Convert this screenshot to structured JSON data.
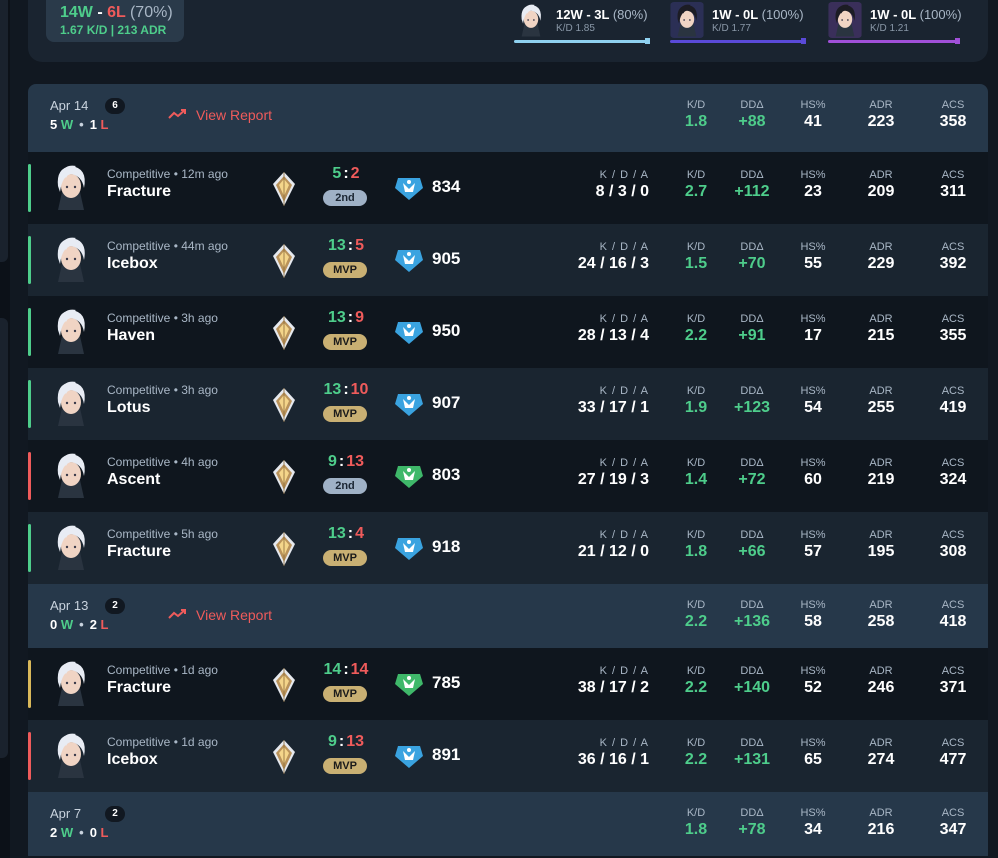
{
  "summary": {
    "wins": "14W",
    "dash": " - ",
    "losses": "6L",
    "winrate": "(70%)",
    "kd_adr": "1.67 K/D | 213 ADR"
  },
  "agent_stats": [
    {
      "record": "12W - 3L",
      "pct": "(80%)",
      "kd": "K/D 1.85",
      "bar_color": "#8fd1f0"
    },
    {
      "record": "1W - 0L",
      "pct": "(100%)",
      "kd": "K/D 1.77",
      "bar_color": "#5a4ad8"
    },
    {
      "record": "1W - 0L",
      "pct": "(100%)",
      "kd": "K/D 1.21",
      "bar_color": "#a050d8"
    }
  ],
  "stat_labels": {
    "kd": "K/D",
    "dd": "DDΔ",
    "hs": "HS%",
    "adr": "ADR",
    "acs": "ACS",
    "kda": "K / D / A"
  },
  "days": [
    {
      "date": "Apr 14",
      "count": "6",
      "wins": "5",
      "w": "W",
      "dot": "•",
      "losses": "1",
      "l": "L",
      "report": "View Report",
      "kd": "1.8",
      "dd": "+88",
      "hs": "41",
      "adr": "223",
      "acs": "358"
    },
    {
      "date": "Apr 13",
      "count": "2",
      "wins": "0",
      "w": "W",
      "dot": "•",
      "losses": "2",
      "l": "L",
      "report": "View Report",
      "kd": "2.2",
      "dd": "+136",
      "hs": "58",
      "adr": "258",
      "acs": "418"
    },
    {
      "date": "Apr 7",
      "count": "2",
      "wins": "2",
      "w": "W",
      "dot": "•",
      "losses": "0",
      "l": "L",
      "kd": "1.8",
      "dd": "+78",
      "hs": "34",
      "adr": "216",
      "acs": "347"
    }
  ],
  "matches": [
    {
      "mode": "Competitive • 12m ago",
      "map": "Fracture",
      "score_a": "5",
      "score_b": "2",
      "badge": "2nd",
      "rr": "834",
      "kda": "8 / 3 / 0",
      "kd": "2.7",
      "dd": "+112",
      "hs": "23",
      "adr": "209",
      "acs": "311",
      "result_color": "#4ecd8b",
      "tier_color": "#3aa3e0"
    },
    {
      "mode": "Competitive • 44m ago",
      "map": "Icebox",
      "score_a": "13",
      "score_b": "5",
      "badge": "MVP",
      "rr": "905",
      "kda": "24 / 16 / 3",
      "kd": "1.5",
      "dd": "+70",
      "hs": "55",
      "adr": "229",
      "acs": "392",
      "result_color": "#4ecd8b",
      "tier_color": "#3aa3e0"
    },
    {
      "mode": "Competitive • 3h ago",
      "map": "Haven",
      "score_a": "13",
      "score_b": "9",
      "badge": "MVP",
      "rr": "950",
      "kda": "28 / 13 / 4",
      "kd": "2.2",
      "dd": "+91",
      "hs": "17",
      "adr": "215",
      "acs": "355",
      "result_color": "#4ecd8b",
      "tier_color": "#3aa3e0"
    },
    {
      "mode": "Competitive • 3h ago",
      "map": "Lotus",
      "score_a": "13",
      "score_b": "10",
      "badge": "MVP",
      "rr": "907",
      "kda": "33 / 17 / 1",
      "kd": "1.9",
      "dd": "+123",
      "hs": "54",
      "adr": "255",
      "acs": "419",
      "result_color": "#4ecd8b",
      "tier_color": "#3aa3e0"
    },
    {
      "mode": "Competitive • 4h ago",
      "map": "Ascent",
      "score_a": "9",
      "score_b": "13",
      "badge": "2nd",
      "rr": "803",
      "kda": "27 / 19 / 3",
      "kd": "1.4",
      "dd": "+72",
      "hs": "60",
      "adr": "219",
      "acs": "324",
      "result_color": "#ef5b5b",
      "tier_color": "#3fb86a"
    },
    {
      "mode": "Competitive • 5h ago",
      "map": "Fracture",
      "score_a": "13",
      "score_b": "4",
      "badge": "MVP",
      "rr": "918",
      "kda": "21 / 12 / 0",
      "kd": "1.8",
      "dd": "+66",
      "hs": "57",
      "adr": "195",
      "acs": "308",
      "result_color": "#4ecd8b",
      "tier_color": "#3aa3e0"
    },
    {
      "mode": "Competitive • 1d ago",
      "map": "Fracture",
      "score_a": "14",
      "score_b": "14",
      "badge": "MVP",
      "rr": "785",
      "kda": "38 / 17 / 2",
      "kd": "2.2",
      "dd": "+140",
      "hs": "52",
      "adr": "246",
      "acs": "371",
      "result_color": "#d9b85a",
      "tier_color": "#3fb86a"
    },
    {
      "mode": "Competitive • 1d ago",
      "map": "Icebox",
      "score_a": "9",
      "score_b": "13",
      "badge": "MVP",
      "rr": "891",
      "kda": "36 / 16 / 1",
      "kd": "2.2",
      "dd": "+131",
      "hs": "65",
      "adr": "274",
      "acs": "477",
      "result_color": "#ef5b5b",
      "tier_color": "#3aa3e0"
    }
  ],
  "icons": {
    "report": "trend-line-icon",
    "rank": "gold-rank-icon",
    "tier": "rr-tier-icon",
    "agent": "agent-portrait"
  }
}
